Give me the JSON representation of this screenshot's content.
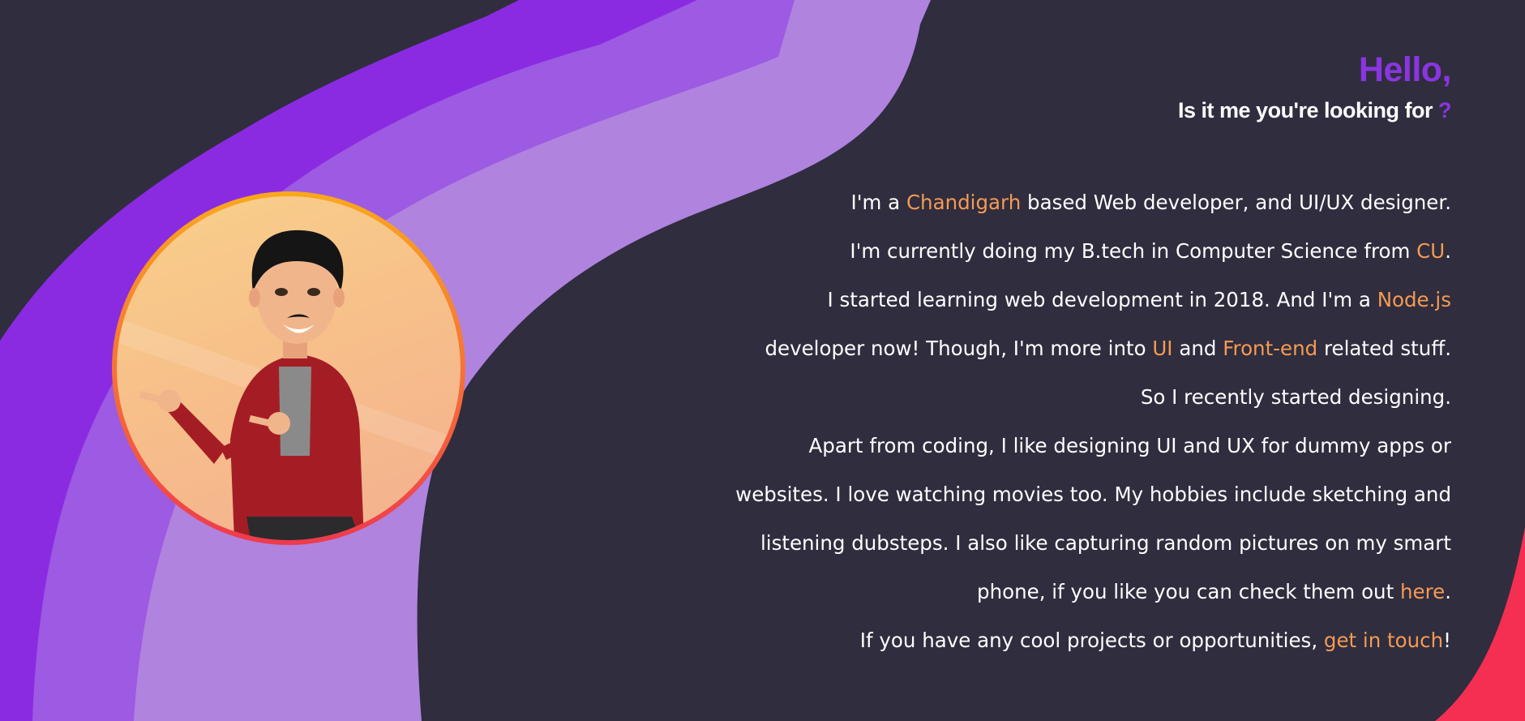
{
  "colors": {
    "background": "#2f2d3e",
    "accent_purple": "#8a35e0",
    "highlight_orange": "#f59a54",
    "wave_dark": "#8a2be2",
    "wave_mid": "#9d5ae2",
    "wave_light": "#b083df",
    "corner_red": "#f42f51"
  },
  "header": {
    "greeting": "Hello,",
    "subtitle": "Is it me you're looking for",
    "question_mark": "?"
  },
  "avatar": {
    "icon": "cartoon-avatar-icon"
  },
  "bio": {
    "l1_a": "I'm a ",
    "l1_city": "Chandigarh",
    "l1_b": " based Web developer, and UI/UX designer.",
    "l2_a": "I'm currently doing my B.tech in Computer Science from ",
    "l2_cu": "CU",
    "l2_b": ".",
    "l3_a": "I started learning web development in 2018. And I'm a ",
    "l3_node": "Node.js",
    "l4_a": "developer now! Though, I'm more into ",
    "l4_ui": "UI",
    "l4_b": " and ",
    "l4_fe": "Front-end",
    "l4_c": " related stuff.",
    "l5": "So I recently started designing.",
    "l6": "Apart from coding, I like designing UI and UX for dummy apps or",
    "l7": "websites. I love watching movies too. My hobbies include sketching and",
    "l8": "listening dubsteps. I also like capturing random pictures on my smart",
    "l9_a": "phone, if you like you can check them out ",
    "l9_link": "here",
    "l9_b": ".",
    "l10_a": "If you have any cool projects or opportunities, ",
    "l10_link": "get in touch",
    "l10_b": "!"
  }
}
